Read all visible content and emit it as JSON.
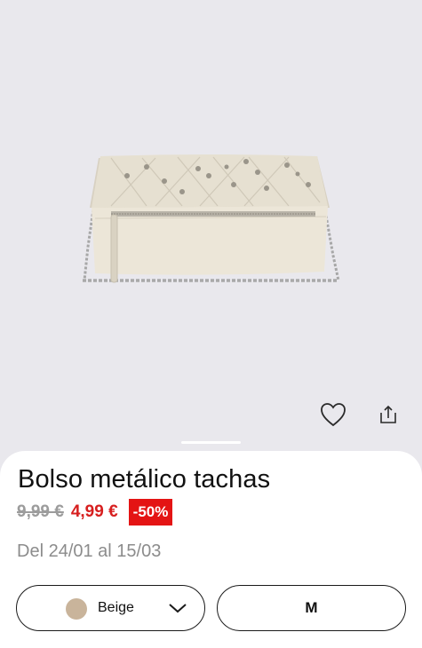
{
  "product": {
    "image": "studded-quilted-beige-clutch-with-chain",
    "name": "Bolso metálico tachas",
    "old_price": "9,99 €",
    "new_price": "4,99 €",
    "discount": "-50%",
    "dates": "Del 24/01 al 15/03"
  },
  "actions": {
    "favorite_icon": "heart-icon",
    "share_icon": "share-icon"
  },
  "selectors": {
    "color": {
      "label": "Beige",
      "swatch": "#c9b49b",
      "icon": "chevron-down-icon"
    },
    "size": {
      "label": "M"
    }
  },
  "colors": {
    "background": "#e9e8ed",
    "sale_red": "#d71f1f",
    "badge_red": "#e41414",
    "muted_gray": "#9c9c9c"
  }
}
